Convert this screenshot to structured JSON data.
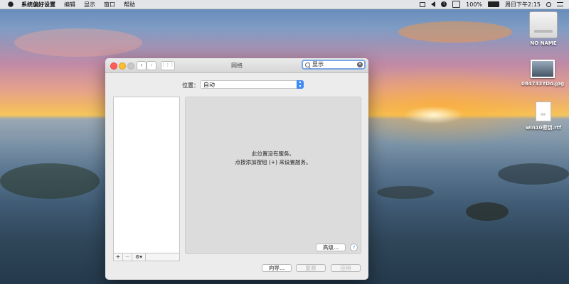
{
  "menubar": {
    "app_name": "系统偏好设置",
    "items": [
      "编辑",
      "显示",
      "窗口",
      "帮助"
    ],
    "battery": "100%",
    "datetime": "周日下午2:15"
  },
  "desktop": {
    "icons": [
      {
        "label": "NO NAME"
      },
      {
        "label": "084733YDo.jpg"
      },
      {
        "label": "win10密钥.rtf",
        "doc_badge": "RTF"
      }
    ]
  },
  "window": {
    "title": "网络",
    "search": {
      "value": "显示"
    },
    "location": {
      "label": "位置：",
      "value": "自动"
    },
    "service_toolbar": {
      "add": "+",
      "remove": "−",
      "gear": "⚙▾"
    },
    "empty_message": {
      "line1": "此位置没有服务。",
      "line2": "点按添加按钮 (+) 来设置服务。"
    },
    "advanced_button": "高级...",
    "help_button": "?",
    "assistant_button": "向导...",
    "revert_button": "复原",
    "apply_button": "应用"
  },
  "colors": {
    "accent": "#3d8af7",
    "close": "#ff5f57",
    "minimize": "#febc2e",
    "zoom": "#c8c8c8"
  }
}
